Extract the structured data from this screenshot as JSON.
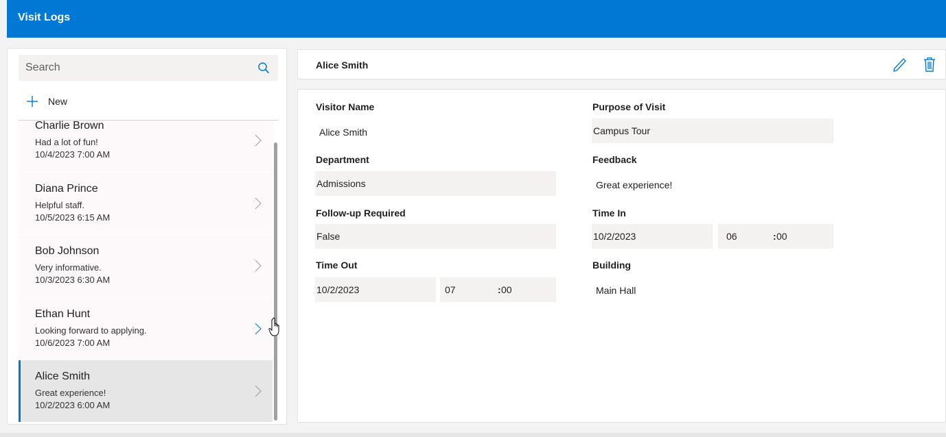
{
  "app": {
    "title": "Visit Logs"
  },
  "search": {
    "placeholder": "Search"
  },
  "toolbar": {
    "new_label": "New"
  },
  "list": {
    "items": [
      {
        "name": "Charlie Brown",
        "feedback": "Had a lot of fun!",
        "date": "10/4/2023 7:00 AM",
        "selected": false
      },
      {
        "name": "Diana Prince",
        "feedback": "Helpful staff.",
        "date": "10/5/2023 6:15 AM",
        "selected": false
      },
      {
        "name": "Bob Johnson",
        "feedback": "Very informative.",
        "date": "10/3/2023 6:30 AM",
        "selected": false
      },
      {
        "name": "Ethan Hunt",
        "feedback": "Looking forward to applying.",
        "date": "10/6/2023 7:00 AM",
        "selected": false
      },
      {
        "name": "Alice Smith",
        "feedback": "Great experience!",
        "date": "10/2/2023 6:00 AM",
        "selected": true
      }
    ]
  },
  "detail": {
    "title": "Alice Smith",
    "fields": {
      "visitor_name": {
        "label": "Visitor Name",
        "value": "Alice Smith"
      },
      "purpose": {
        "label": "Purpose of Visit",
        "value": "Campus Tour"
      },
      "department": {
        "label": "Department",
        "value": "Admissions"
      },
      "feedback": {
        "label": "Feedback",
        "value": "Great experience!"
      },
      "follow_up": {
        "label": "Follow-up Required",
        "value": "False"
      },
      "time_in": {
        "label": "Time In",
        "date": "10/2/2023",
        "hour": "06",
        "minute": "00"
      },
      "time_out": {
        "label": "Time Out",
        "date": "10/2/2023",
        "hour": "07",
        "minute": "00"
      },
      "building": {
        "label": "Building",
        "value": "Main Hall"
      }
    }
  },
  "colors": {
    "accent": "#0078d4",
    "panel_bg": "#f3f2f1",
    "selected_bg": "#e6e6e6"
  },
  "icons": [
    "search-icon",
    "plus-icon",
    "chevron-right-icon",
    "edit-icon",
    "delete-icon",
    "hand-cursor-icon"
  ]
}
